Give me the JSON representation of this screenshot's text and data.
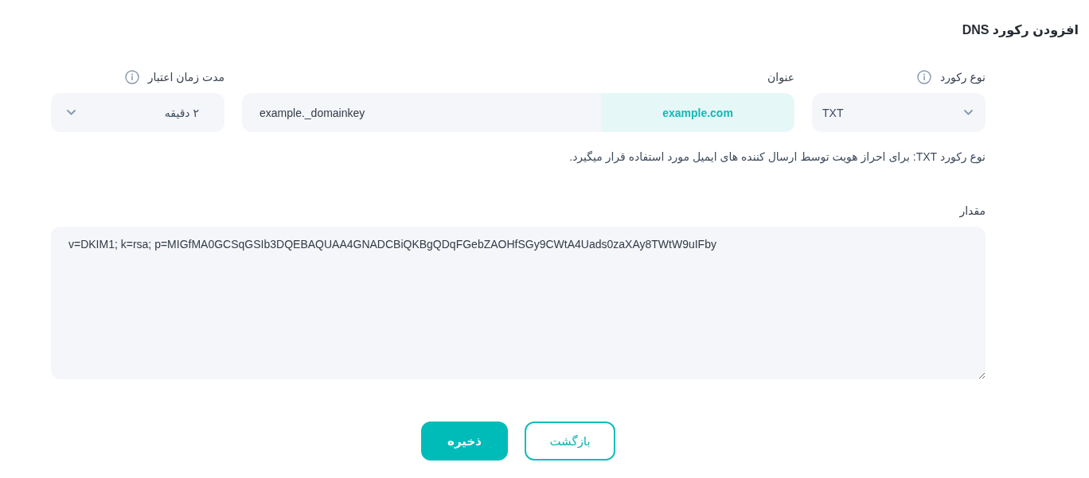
{
  "page": {
    "title": "افزودن رکورد DNS"
  },
  "form": {
    "record_type": {
      "label": "نوع رکورد",
      "value": "TXT"
    },
    "title": {
      "label": "عنوان",
      "value": "example._domainkey",
      "suffix": "example.com"
    },
    "ttl": {
      "label": "مدت زمان اعتبار",
      "value": "۲ دقیقه"
    },
    "hint": "نوع رکورد TXT: برای احراز هویت توسط ارسال کننده های ایمیل مورد استفاده قرار میگیرد.",
    "value_field": {
      "label": "مقدار",
      "value": "v=DKIM1; k=rsa; p=MIGfMA0GCSqGSIb3DQEBAQUAA4GNADCBiQKBgQDqFGebZAOHfSGy9CWtA4Uads0zaXAy8TWtW9uIFby"
    }
  },
  "buttons": [
    {
      "label": "بازگشت",
      "kind": "outline"
    },
    {
      "label": "ذخیره",
      "kind": "primary"
    }
  ]
}
